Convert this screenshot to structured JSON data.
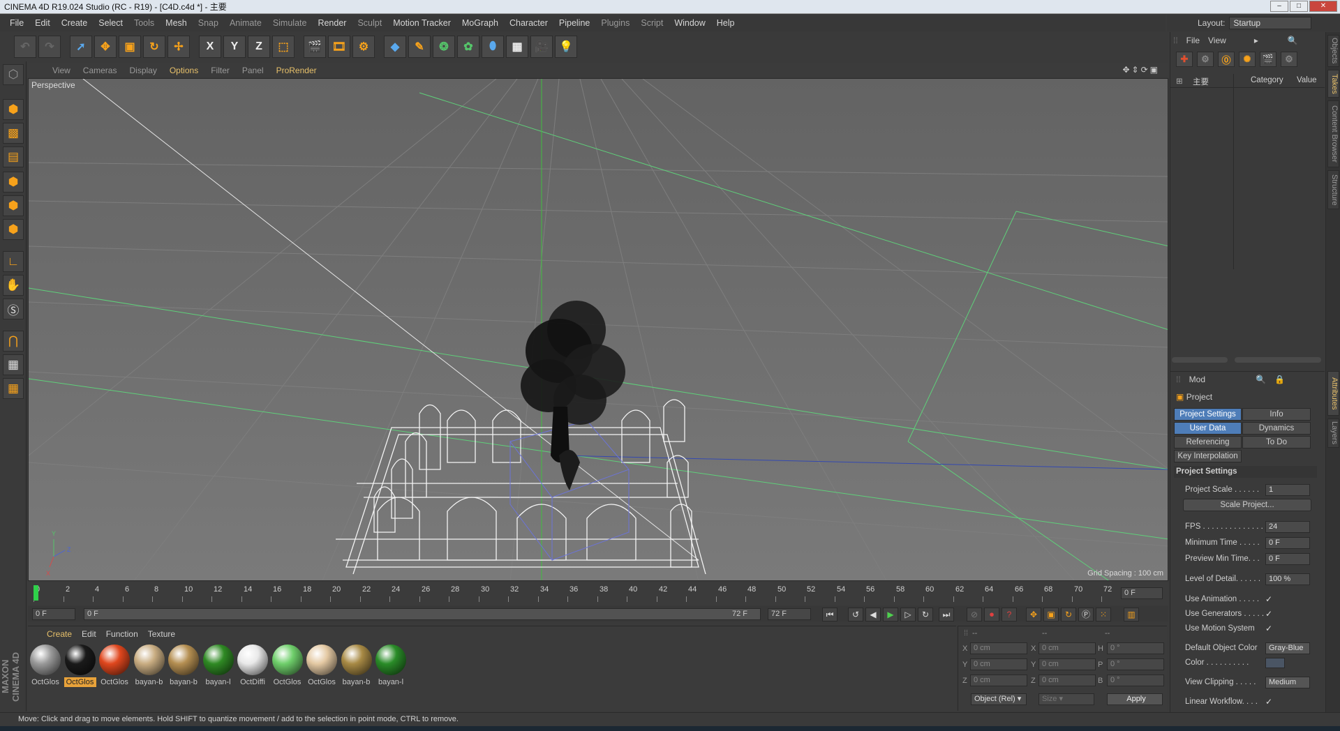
{
  "window": {
    "title": "CINEMA 4D R19.024 Studio (RC - R19) - [C4D.c4d *] - 主要"
  },
  "menubar": [
    "File",
    "Edit",
    "Create",
    "Select",
    "Tools",
    "Mesh",
    "Snap",
    "Animate",
    "Simulate",
    "Render",
    "Sculpt",
    "Motion Tracker",
    "MoGraph",
    "Character",
    "Pipeline",
    "Plugins",
    "Script",
    "Window",
    "Help"
  ],
  "layout": {
    "label": "Layout:",
    "value": "Startup"
  },
  "toolbar": {
    "x": "X",
    "y": "Y",
    "z": "Z"
  },
  "viewport": {
    "menu": [
      "View",
      "Cameras",
      "Display",
      "Options",
      "Filter",
      "Panel",
      "ProRender"
    ],
    "label": "Perspective",
    "grid_spacing": "Grid Spacing : 100 cm"
  },
  "timeline": {
    "ticks": [
      "0",
      "2",
      "4",
      "6",
      "8",
      "10",
      "12",
      "14",
      "16",
      "18",
      "20",
      "22",
      "24",
      "26",
      "28",
      "30",
      "32",
      "34",
      "36",
      "38",
      "40",
      "42",
      "44",
      "46",
      "48",
      "50",
      "52",
      "54",
      "56",
      "58",
      "60",
      "62",
      "64",
      "66",
      "68",
      "70",
      "72"
    ],
    "current_frame": "0 F",
    "start": "0 F",
    "range_start": "0 F",
    "range_end": "72 F",
    "end": "72 F"
  },
  "materials": {
    "menu": [
      "Create",
      "Edit",
      "Function",
      "Texture"
    ],
    "items": [
      {
        "name": "OctGlos",
        "color": "#9a9a9a",
        "selected": false
      },
      {
        "name": "OctGlos",
        "color": "#1a1a1a",
        "selected": true
      },
      {
        "name": "OctGlos",
        "color": "#e0471e",
        "selected": false
      },
      {
        "name": "bayan-b",
        "color": "#c9ad82",
        "selected": false
      },
      {
        "name": "bayan-b",
        "color": "#b58f52",
        "selected": false
      },
      {
        "name": "bayan-l",
        "color": "#2f8a24",
        "selected": false
      },
      {
        "name": "OctDiffi",
        "color": "#e9e9e9",
        "selected": false
      },
      {
        "name": "OctGlos",
        "color": "#6fcf6b",
        "selected": false
      },
      {
        "name": "OctGlos",
        "color": "#e4c9a3",
        "selected": false
      },
      {
        "name": "bayan-b",
        "color": "#a88a45",
        "selected": false
      },
      {
        "name": "bayan-l",
        "color": "#2a8c28",
        "selected": false
      }
    ]
  },
  "coords": {
    "headers": [
      "--",
      "--",
      "--"
    ],
    "rows": [
      {
        "a": "X",
        "av": "0 cm",
        "b": "X",
        "bv": "0 cm",
        "c": "H",
        "cv": "0 °"
      },
      {
        "a": "Y",
        "av": "0 cm",
        "b": "Y",
        "bv": "0 cm",
        "c": "P",
        "cv": "0 °"
      },
      {
        "a": "Z",
        "av": "0 cm",
        "b": "Z",
        "bv": "0 cm",
        "c": "B",
        "cv": "0 °"
      }
    ],
    "mode": "Object (Rel)",
    "size": "Size",
    "apply": "Apply"
  },
  "status": "Move: Click and drag to move elements. Hold SHIFT to quantize movement / add to the selection in point mode, CTRL to remove.",
  "maxon": "MAXON CINEMA 4D",
  "objects": {
    "menu": [
      "File",
      "View"
    ],
    "root": "主要",
    "col_category": "Category",
    "col_value": "Value"
  },
  "attributes": {
    "mode": "Mod",
    "object": "Project",
    "tabs": [
      "Project Settings",
      "Info",
      "User Data",
      "Dynamics",
      "Referencing",
      "To Do",
      "Key Interpolation"
    ],
    "section": "Project Settings",
    "rows": [
      {
        "label": "Project Scale . . . . . .",
        "value": "1"
      },
      {
        "label": "FPS . . . . . . . . . . . . . .",
        "value": "24"
      },
      {
        "label": "Minimum Time . . . . .",
        "value": "0 F"
      },
      {
        "label": "Preview Min Time. . .",
        "value": "0 F"
      },
      {
        "label": "Level of Detail. . . . . .",
        "value": "100 %"
      }
    ],
    "scale_btn": "Scale Project...",
    "checks": [
      {
        "label": "Use Animation . . . . .",
        "value": "✓"
      },
      {
        "label": "Use Generators . . . . .",
        "value": "✓"
      },
      {
        "label": "Use Motion System",
        "value": "✓"
      }
    ],
    "default_color_label": "Default Object Color",
    "default_color_value": "Gray-Blue",
    "color_label": "Color . . . . . . . . . .",
    "view_clipping_label": "View Clipping . . . . .",
    "view_clipping_value": "Medium",
    "linear_label": "Linear Workflow. . . .",
    "linear_value": "✓"
  },
  "side_tabs": [
    "Objects",
    "Takes",
    "Content Browser",
    "Structure",
    "Attributes",
    "Layers"
  ]
}
